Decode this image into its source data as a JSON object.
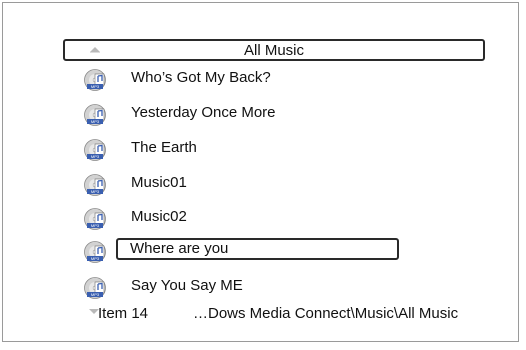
{
  "header": {
    "title": "All Music",
    "up_icon": "scroll-up-arrow-icon"
  },
  "list": {
    "icon": "mp3-disc-icon",
    "icon_badge": "MP3",
    "items": [
      {
        "label": "Who’s Got My Back?",
        "selected": false
      },
      {
        "label": "Yesterday Once More",
        "selected": false
      },
      {
        "label": "The Earth",
        "selected": false
      },
      {
        "label": "Music01",
        "selected": false
      },
      {
        "label": "Music02",
        "selected": false
      },
      {
        "label": "Where are you",
        "selected": true
      },
      {
        "label": "Say You Say ME",
        "selected": false
      }
    ]
  },
  "footer": {
    "down_icon": "scroll-down-arrow-icon",
    "item_counter": "Item 14",
    "path": "…Dows Media Connect\\Music\\All Music"
  },
  "colors": {
    "background": "#ffffff",
    "border": "#2a2a2a",
    "text": "#111111",
    "disc_blue": "#3a5fb0",
    "disc_silver": "#c8c8c8"
  }
}
